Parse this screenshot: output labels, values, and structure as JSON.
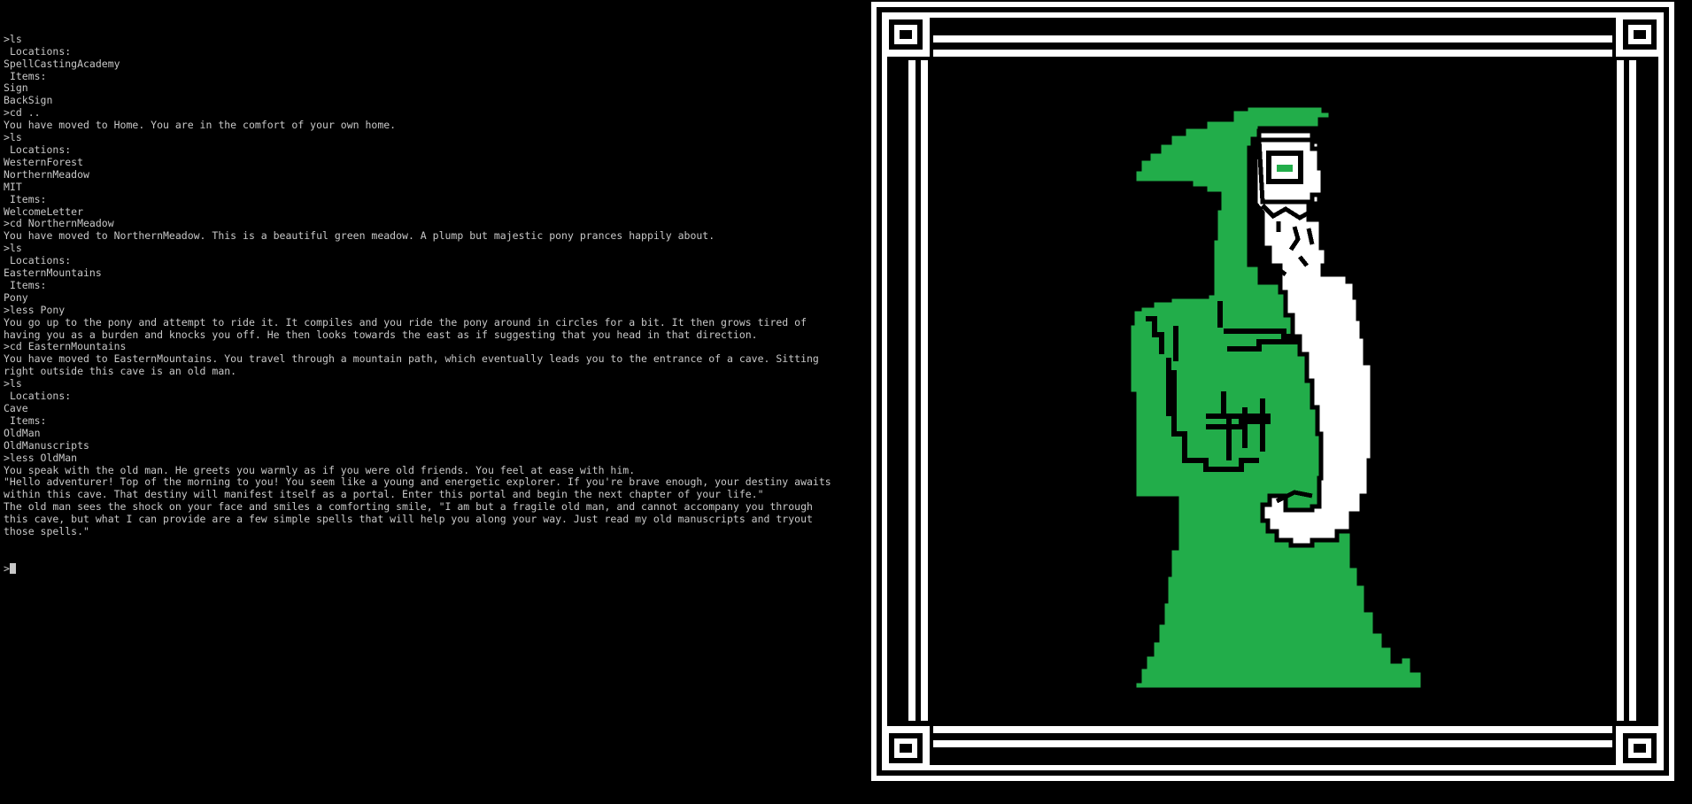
{
  "terminal": {
    "lines": [
      ">ls",
      " Locations:",
      "SpellCastingAcademy",
      " Items:",
      "Sign",
      "BackSign",
      ">cd ..",
      "You have moved to Home. You are in the comfort of your own home.",
      ">ls",
      " Locations:",
      "WesternForest",
      "NorthernMeadow",
      "MIT",
      " Items:",
      "WelcomeLetter",
      ">cd NorthernMeadow",
      "You have moved to NorthernMeadow. This is a beautiful green meadow. A plump but majestic pony prances happily about.",
      ">ls",
      " Locations:",
      "EasternMountains",
      " Items:",
      "Pony",
      ">less Pony",
      "You go up to the pony and attempt to ride it. It compiles and you ride the pony around in circles for a bit. It then grows tired of",
      "having you as a burden and knocks you off. He then looks towards the east as if suggesting that you head in that direction.",
      ">cd EasternMountains",
      "You have moved to EasternMountains. You travel through a mountain path, which eventually leads you to the entrance of a cave. Sitting",
      "right outside this cave is an old man.",
      ">ls",
      " Locations:",
      "Cave",
      " Items:",
      "OldMan",
      "OldManuscripts",
      ">less OldMan",
      "You speak with the old man. He greets you warmly as if you were old friends. You feel at ease with him.",
      "\"Hello adventurer! Top of the morning to you! You seem like a young and energetic explorer. If you're brave enough, your destiny awaits",
      "within this cave. That destiny will manifest itself as a portal. Enter this portal and begin the next chapter of your life.\"",
      "The old man sees the shock on your face and smiles a comforting smile, \"I am but a fragile old man, and cannot accompany you through",
      "this cave, but what I can provide are a few simple spells that will help you along your way. Just read my old manuscripts and tryout",
      "those spells.\""
    ],
    "prompt": ">"
  },
  "art": {
    "subject": "old-man-wizard",
    "colors": {
      "background": "#000000",
      "frame": "#ffffff",
      "robe": "#22ad4a",
      "beard": "#ffffff",
      "outline": "#000000",
      "text": "#c8c8c8"
    }
  }
}
